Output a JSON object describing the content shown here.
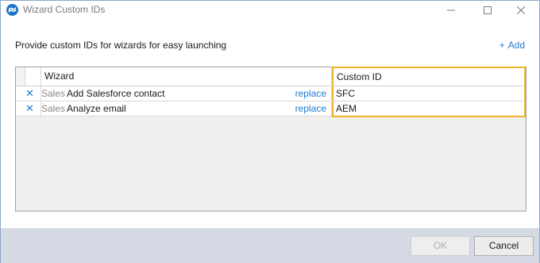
{
  "window": {
    "title": "Wizard Custom IDs",
    "controls": {
      "minimize": "minimize-icon",
      "maximize": "maximize-icon",
      "close": "close-icon"
    }
  },
  "instructions": "Provide custom IDs for wizards for easy launching",
  "add": {
    "icon": "+",
    "label": "Add"
  },
  "grid": {
    "columns": {
      "wizard": "Wizard",
      "custom_id": "Custom ID"
    },
    "rows": [
      {
        "remove_icon": "✕",
        "category": "Sales",
        "name": "Add Salesforce contact",
        "replace": "replace",
        "custom_id": "SFC"
      },
      {
        "remove_icon": "✕",
        "category": "Sales",
        "name": "Analyze email",
        "replace": "replace",
        "custom_id": "AEM"
      }
    ]
  },
  "footer": {
    "ok_label": "OK",
    "cancel_label": "Cancel"
  },
  "colors": {
    "accent": "#1e7bd0",
    "highlight": "#f0b429",
    "footer_bg": "#d5d9e4"
  }
}
